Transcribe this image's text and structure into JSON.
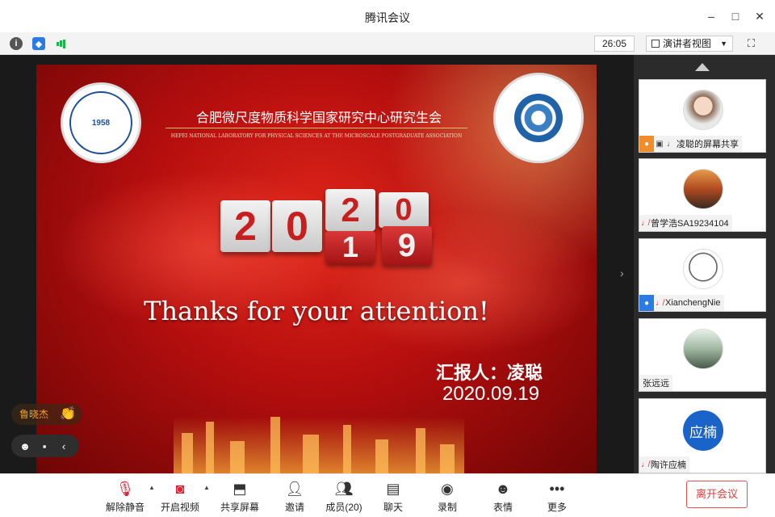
{
  "window": {
    "title": "腾讯会议",
    "controls": {
      "minimize": "–",
      "maximize": "□",
      "close": "✕"
    }
  },
  "infobar": {
    "timer": "26:05",
    "view_mode": "演讲者视图",
    "icons": [
      "info-icon",
      "shield-icon",
      "signal-icon",
      "fullscreen-icon"
    ]
  },
  "slide": {
    "org_cn": "合肥微尺度物质科学国家研究中心研究生会",
    "org_en": "HEFEI NATIONAL LABORATORY FOR PHYSICAL SCIENCES AT THE MICROSCALE POSTGRADUATE ASSOCIATION",
    "logo_left_year": "1958",
    "year_digits": [
      "2",
      "0",
      "2",
      "0"
    ],
    "year_digits_back": [
      "1",
      "9"
    ],
    "thanks": "Thanks for your attention!",
    "reporter": "汇报人：凌聪",
    "date": "2020.09.19"
  },
  "overlays": {
    "reaction_name": "鲁晓杰",
    "reaction_icon": "👏"
  },
  "participants": [
    {
      "name": "凌聪的屏幕共享",
      "tag": "host",
      "sharing": true
    },
    {
      "name": "曾学浩SA19234104",
      "tag": "",
      "sharing": false
    },
    {
      "name": "XianchengNie",
      "tag": "user",
      "sharing": false
    },
    {
      "name": "张远远",
      "tag": "",
      "sharing": false
    },
    {
      "name": "陶许应楠",
      "tag": "",
      "sharing": false,
      "avatar_text": "应楠"
    }
  ],
  "toolbar": {
    "mute": "解除静音",
    "video": "开启视频",
    "share": "共享屏幕",
    "invite": "邀请",
    "members": "成员(20)",
    "chat": "聊天",
    "record": "录制",
    "emoji": "表情",
    "more": "更多",
    "leave": "离开会议"
  },
  "colors": {
    "accent": "#1a63c9",
    "leave": "#e03c3c",
    "slide_red": "#c71e1e",
    "signal_green": "#22b14c"
  }
}
